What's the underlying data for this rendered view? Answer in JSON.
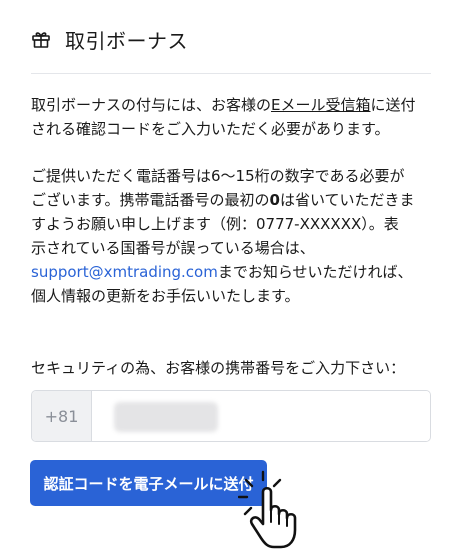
{
  "header": {
    "title": "取引ボーナス",
    "icon": "gift-icon"
  },
  "paragraph1": {
    "line1_pre": "取引ボーナスの付与には、お客様の",
    "line1_link": "Eメール受信箱",
    "line1_post": "に送付",
    "line2": "される確認コードをご入力いただく必要があります。"
  },
  "paragraph2": {
    "line1": "ご提供いただく電話番号は6〜15桁の数字である必要が",
    "line2_pre": "ございます。携帯電話番号の最初の",
    "line2_bold": "0",
    "line2_post": "は省いていただきま",
    "line3": "すようお願い申し上げます（例：0777-XXXXXX）。表",
    "line4": "示されている国番号が誤っている場合は、",
    "line5_link": "support@xmtrading.com",
    "line5_post": "までお知らせいただければ、",
    "line6": "個人情報の更新をお手伝いいたします。"
  },
  "phone_field": {
    "label": "セキュリティの為、お客様の携帯番号をご入力下さい：",
    "country_code": "+81",
    "value": ""
  },
  "send_button": {
    "label": "認証コードを電子メールに送付"
  },
  "colors": {
    "accent": "#2a63d6",
    "link": "#2a63d6",
    "prefix_bg": "#f0f1f3",
    "border": "#d9dce1"
  },
  "icons": [
    "gift-icon",
    "hand-pointer-icon"
  ]
}
